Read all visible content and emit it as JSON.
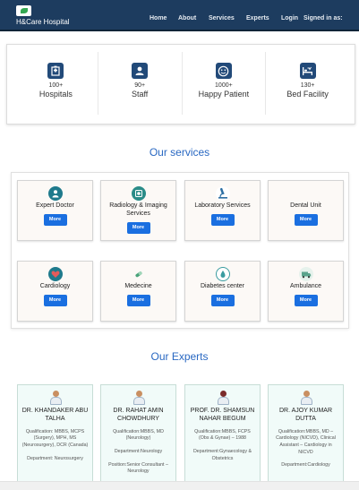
{
  "navbar": {
    "brand": "H&Care Hospital",
    "links": [
      "Home",
      "About",
      "Services",
      "Experts",
      "Login",
      "Signed in as:"
    ]
  },
  "stats": [
    {
      "icon": "hospital-icon",
      "count": "100+",
      "label": "Hospitals"
    },
    {
      "icon": "staff-icon",
      "count": "90+",
      "label": "Staff"
    },
    {
      "icon": "smiley-icon",
      "count": "1000+",
      "label": "Happy Patient"
    },
    {
      "icon": "bed-icon",
      "count": "130+",
      "label": "Bed Facility"
    }
  ],
  "services": {
    "title": "Our services",
    "button_label": "More",
    "items": [
      {
        "title": "Expert Doctor",
        "icon": "doctor-icon",
        "color": "#1f7a8c"
      },
      {
        "title": "Radiology & Imaging Services",
        "icon": "radiology-icon",
        "color": "#2a8c88"
      },
      {
        "title": "Laboratory Services",
        "icon": "microscope-icon",
        "color": "#2d6fa3"
      },
      {
        "title": "Dental Unit",
        "icon": "tooth-icon",
        "color": "#ffffff"
      },
      {
        "title": "Cardiology",
        "icon": "heart-icon",
        "color": "#1f7a8c"
      },
      {
        "title": "Medecine",
        "icon": "pill-icon",
        "color": "#4aa37a"
      },
      {
        "title": "Diabetes center",
        "icon": "glucose-icon",
        "color": "#3a9ca0"
      },
      {
        "title": "Ambulance",
        "icon": "ambulance-icon",
        "color": "#5aa48c"
      }
    ]
  },
  "experts": {
    "title": "Our Experts",
    "items": [
      {
        "name": "DR. KHANDAKER ABU TALHA",
        "qualification": "Qualification: MBBS, MCPS (Surgery), MPH, MS (Neurosurgery), DCR (Canada)",
        "department": "Department: Neurosurgery"
      },
      {
        "name": "DR. RAHAT AMIN CHOWDHURY",
        "qualification": "Qualification:MBBS, MD (Neurology)",
        "department": "Department:Neurology",
        "position": "Position:Senior Consultant – Neurology"
      },
      {
        "name": "PROF. DR. SHAMSUN NAHAR BEGUM",
        "qualification": "Qualification:MBBS, FCPS (Obs & Gynae) – 1988",
        "department": "Department:Gynaecology & Obstetrics"
      },
      {
        "name": "DR. AJOY KUMAR DUTTA",
        "qualification": "Qualification:MBBS, MD – Cardiology (NICVD), Clinical Assistant – Cardiology in NICVD",
        "department": "Department:Cardiology"
      }
    ]
  }
}
